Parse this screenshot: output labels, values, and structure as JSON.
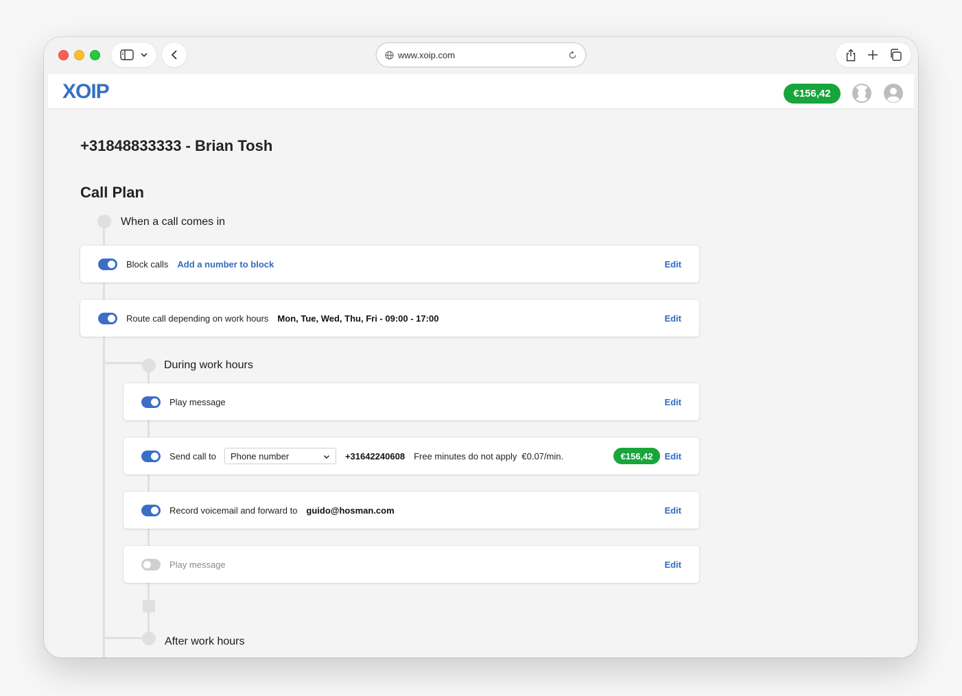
{
  "browser": {
    "url": "www.xoip.com"
  },
  "app": {
    "logo": "XOIP",
    "balance": "€156,42"
  },
  "page": {
    "title": "+31848833333 - Brian Tosh",
    "section_title": "Call Plan",
    "trigger_label": "When a call comes in",
    "block_calls": {
      "label": "Block calls",
      "link": "Add a number to block",
      "edit": "Edit",
      "enabled": true
    },
    "route_hours": {
      "label": "Route call depending on work hours",
      "schedule": "Mon, Tue, Wed, Thu, Fri - 09:00 - 17:00",
      "edit": "Edit",
      "enabled": true
    },
    "during_hours": {
      "label": "During work hours",
      "play_message": {
        "label": "Play message",
        "edit": "Edit",
        "enabled": true
      },
      "send_call": {
        "label": "Send call to",
        "select_value": "Phone number",
        "number": "+31642240608",
        "fee_note": "Free minutes do not apply",
        "rate": "€0.07/min.",
        "balance": "€156,42",
        "edit": "Edit",
        "enabled": true
      },
      "voicemail": {
        "label": "Record voicemail and forward to",
        "email": "guido@hosman.com",
        "edit": "Edit",
        "enabled": true
      },
      "play_message_disabled": {
        "label": "Play message",
        "edit": "Edit",
        "enabled": false
      }
    },
    "after_hours": {
      "label": "After work hours"
    }
  }
}
